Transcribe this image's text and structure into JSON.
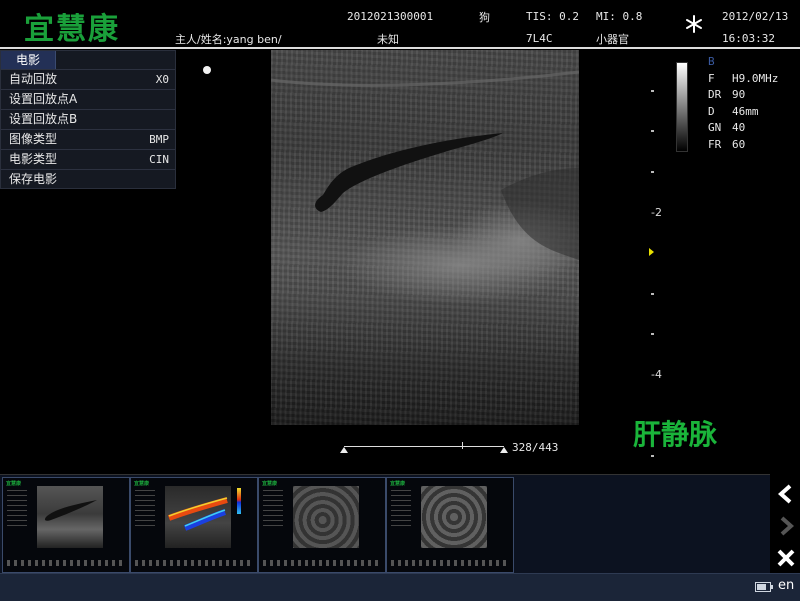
{
  "header": {
    "logo_text": "宜慧康",
    "patient_id": "2012021300001",
    "species": "狗",
    "tis": "TIS: 0.2",
    "mi": "MI: 0.8",
    "date": "2012/02/13",
    "owner_name": "主人/姓名:yang ben/",
    "unknown_label": "未知",
    "probe": "7L4C",
    "preset": "小器官",
    "time": "16:03:32",
    "freeze_icon": "snowflake-icon"
  },
  "menu": {
    "title": "电影",
    "items": [
      {
        "label": "自动回放",
        "value": "X0"
      },
      {
        "label": "设置回放点A",
        "value": ""
      },
      {
        "label": "设置回放点B",
        "value": ""
      },
      {
        "label": "图像类型",
        "value": "BMP"
      },
      {
        "label": "电影类型",
        "value": "CIN"
      },
      {
        "label": "保存电影",
        "value": ""
      }
    ]
  },
  "params": {
    "mode": "B",
    "rows": [
      {
        "key": "F",
        "value": "H9.0MHz"
      },
      {
        "key": "DR",
        "value": "90"
      },
      {
        "key": "D",
        "value": "46mm"
      },
      {
        "key": "GN",
        "value": "40"
      },
      {
        "key": "FR",
        "value": "60"
      }
    ]
  },
  "depth_scale": {
    "labels": [
      "-2",
      "-4"
    ]
  },
  "annotation": "肝静脉",
  "cine": {
    "counter": "328/443",
    "position_fraction": 0.74
  },
  "thumbnails": [
    {
      "name": "thumbnail-1",
      "logo": "宜慧康"
    },
    {
      "name": "thumbnail-2",
      "logo": "宜慧康"
    },
    {
      "name": "thumbnail-3",
      "logo": "宜慧康"
    },
    {
      "name": "thumbnail-4",
      "logo": "宜慧康"
    }
  ],
  "tools": {
    "prev_icon": "chevron-left-icon",
    "next_icon": "chevron-right-icon",
    "close_icon": "close-icon"
  },
  "status": {
    "language": "en",
    "battery_icon": "battery-icon"
  },
  "colors": {
    "logo": "#1aa03a",
    "annotation": "#1ab43a",
    "menu_title_bg": "#233056",
    "status_bar": "#1b2538"
  }
}
